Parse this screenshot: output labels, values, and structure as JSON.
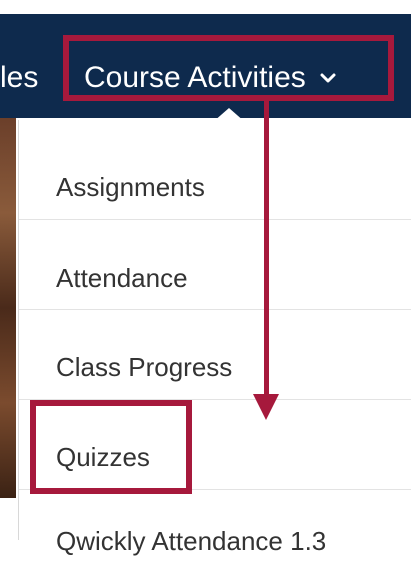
{
  "navbar": {
    "partial_label": "les",
    "course_activities_label": "Course Activities",
    "chevron_icon": "chevron-down-icon",
    "background": "#0e2a4d"
  },
  "menu": {
    "items": [
      {
        "label": "Assignments"
      },
      {
        "label": "Attendance"
      },
      {
        "label": "Class Progress"
      },
      {
        "label": "Quizzes"
      },
      {
        "label": "Qwickly Attendance 1.3"
      }
    ]
  },
  "annotation": {
    "color": "#a6193c"
  }
}
